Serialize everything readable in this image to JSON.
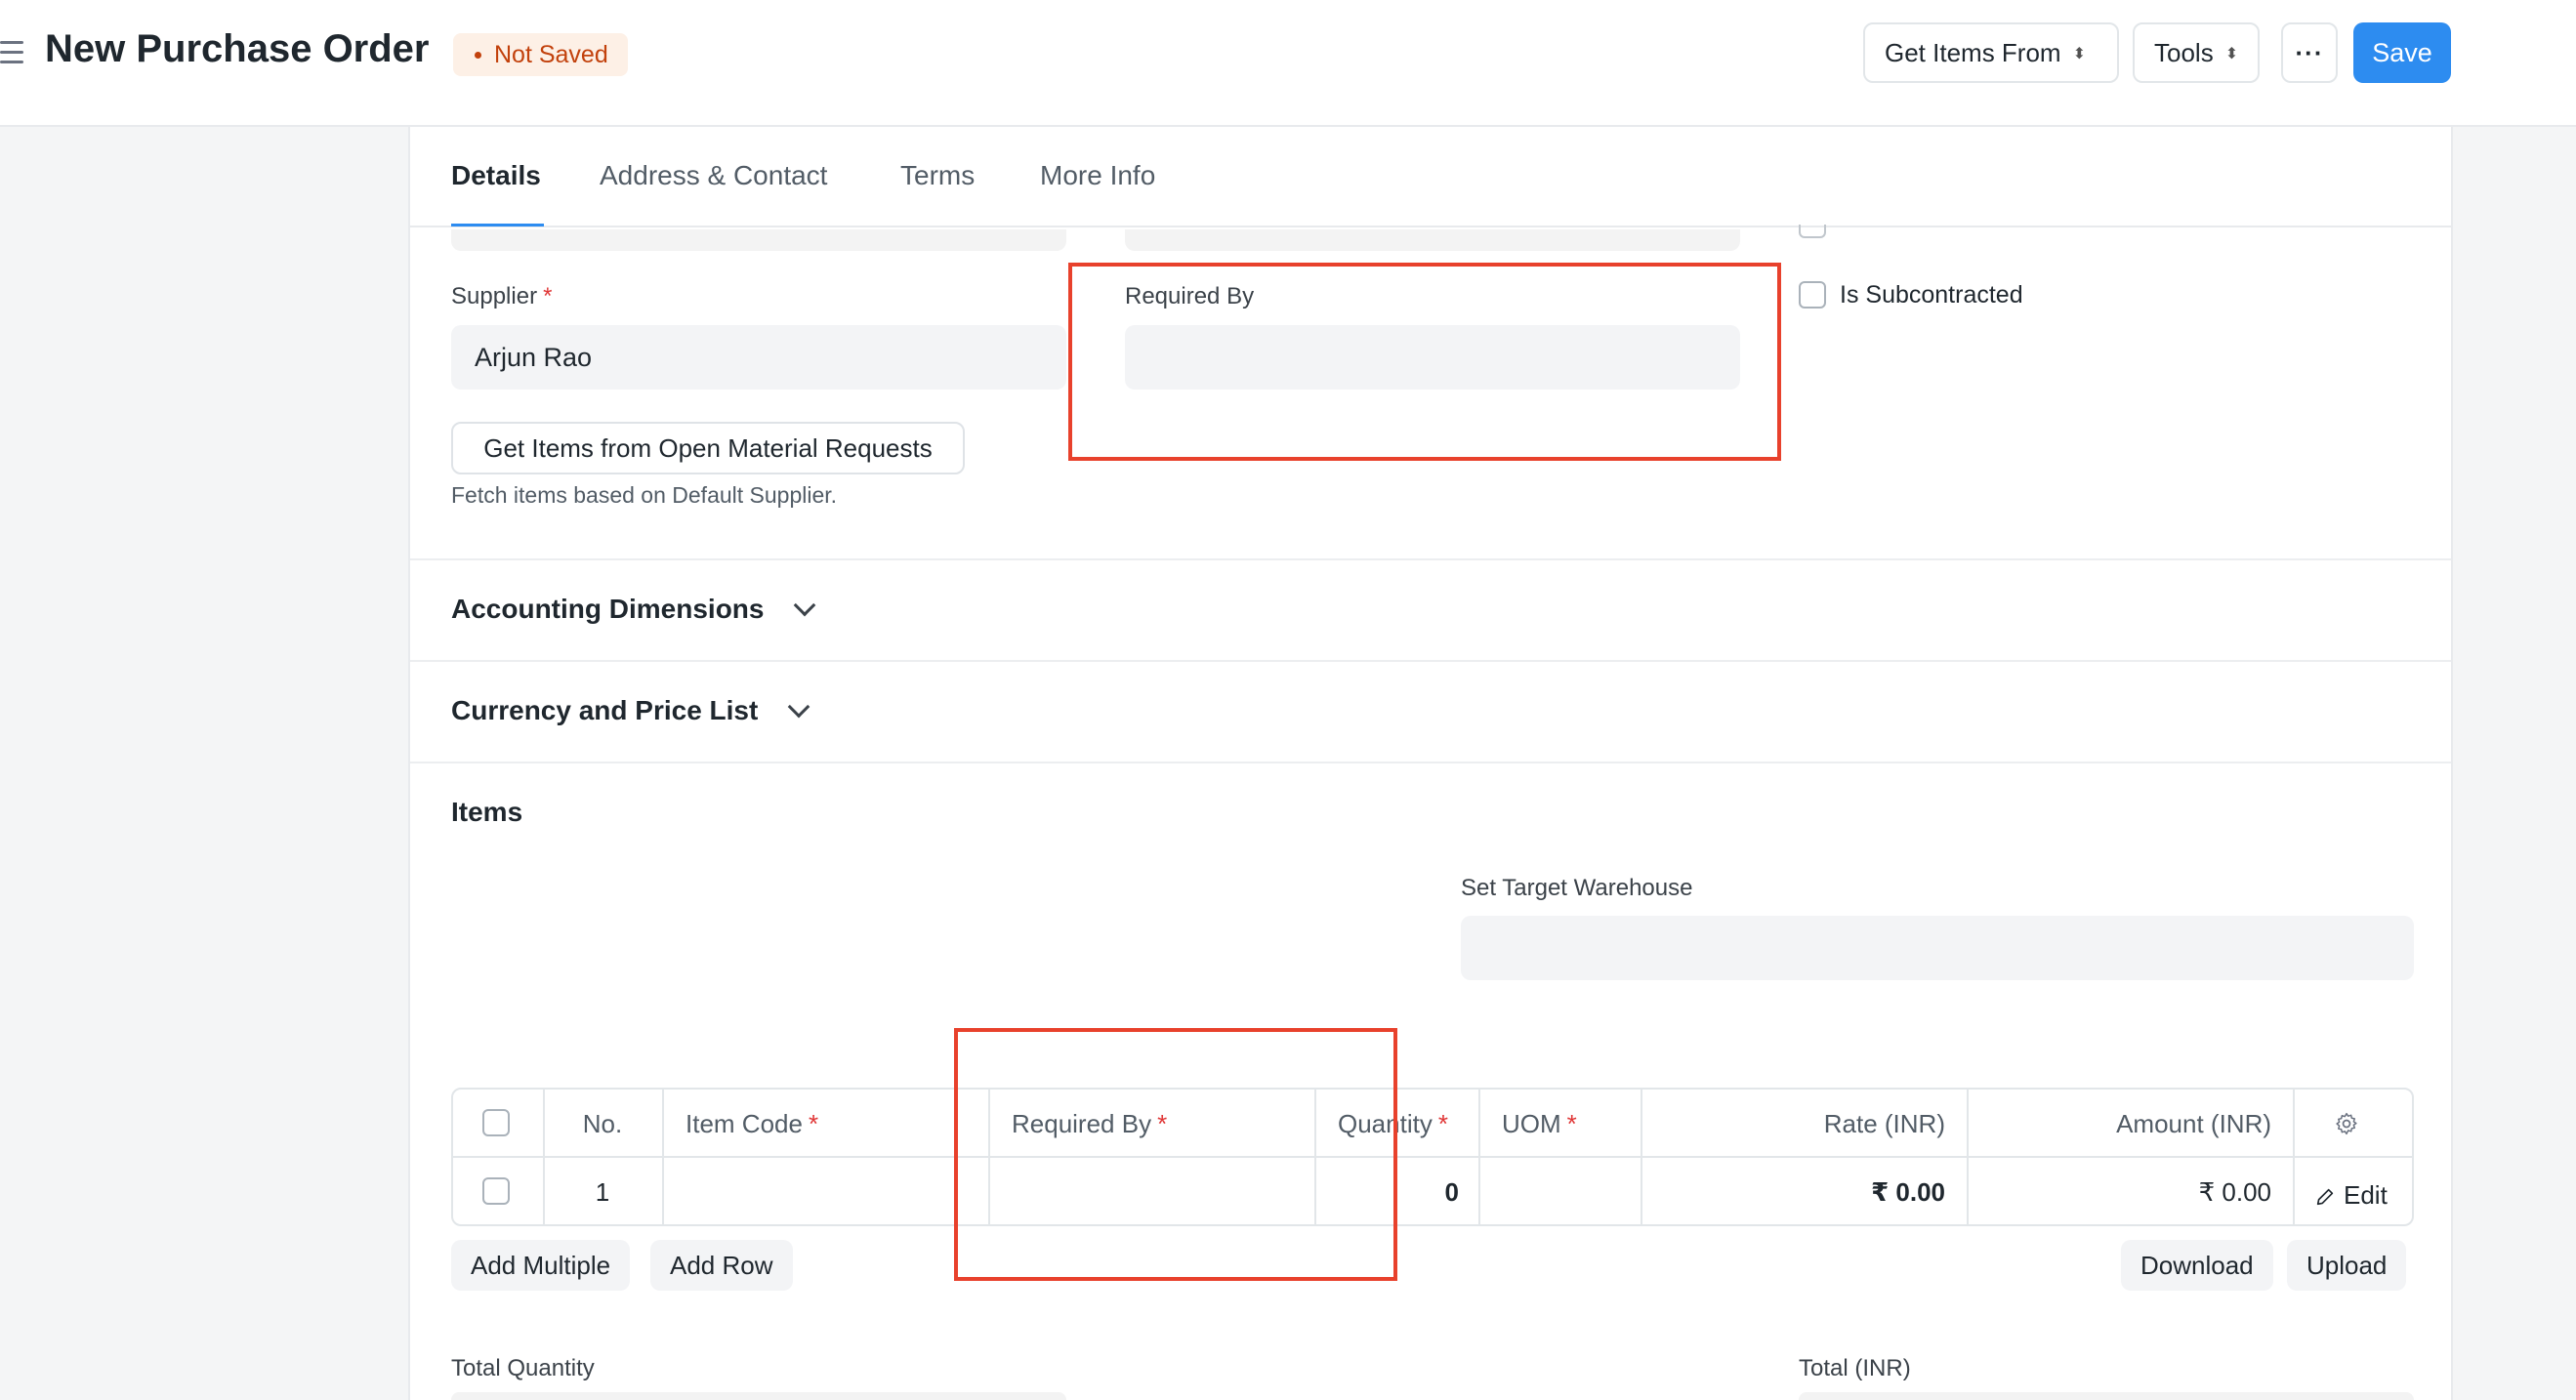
{
  "header": {
    "title": "New Purchase Order",
    "status": "Not Saved",
    "get_items_label": "Get Items From",
    "tools_label": "Tools",
    "more_label": "···",
    "save_label": "Save"
  },
  "tabs": [
    {
      "label": "Details",
      "active": true
    },
    {
      "label": "Address & Contact",
      "active": false
    },
    {
      "label": "Terms",
      "active": false
    },
    {
      "label": "More Info",
      "active": false
    }
  ],
  "form": {
    "supplier_label": "Supplier",
    "supplier_value": "Arjun Rao",
    "required_by_label": "Required By",
    "required_by_value": "",
    "is_subcontracted_label": "Is Subcontracted",
    "open_mr_button": "Get Items from Open Material Requests",
    "open_mr_help": "Fetch items based on Default Supplier."
  },
  "sections": {
    "accounting_dimensions": "Accounting Dimensions",
    "currency_price_list": "Currency and Price List",
    "items": "Items"
  },
  "items": {
    "set_target_warehouse_label": "Set Target Warehouse",
    "set_target_warehouse_value": "",
    "columns": {
      "no": "No.",
      "item_code": "Item Code",
      "required_by": "Required By",
      "quantity": "Quantity",
      "uom": "UOM",
      "rate": "Rate (INR)",
      "amount": "Amount (INR)"
    },
    "rows": [
      {
        "no": "1",
        "item_code": "",
        "required_by": "",
        "quantity": "0",
        "uom": "",
        "rate": "₹ 0.00",
        "amount": "₹ 0.00",
        "edit": "Edit"
      }
    ],
    "add_multiple": "Add Multiple",
    "add_row": "Add Row",
    "download": "Download",
    "upload": "Upload"
  },
  "totals": {
    "total_quantity_label": "Total Quantity",
    "total_inr_label": "Total (INR)"
  },
  "colors": {
    "accent": "#2d8cf0",
    "status": "#c2410c",
    "annotation": "#e8412c",
    "required": "#e03636"
  }
}
